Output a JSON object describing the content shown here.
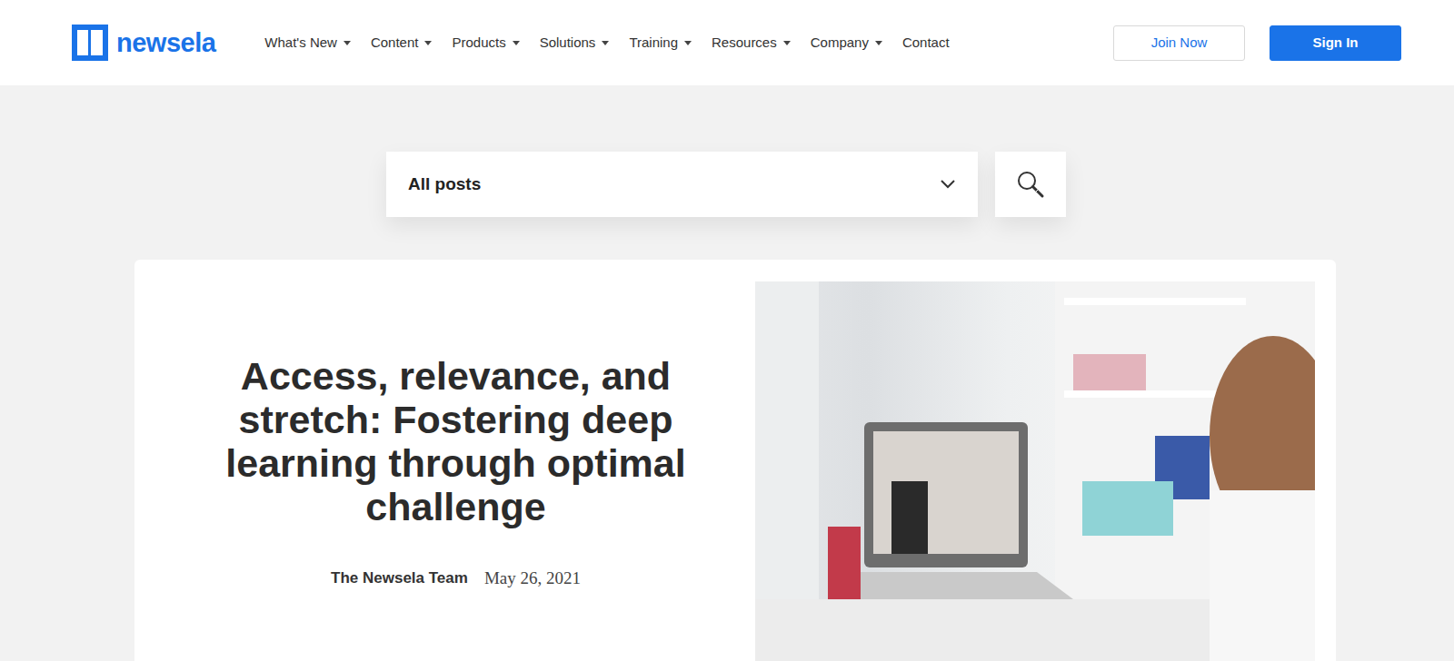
{
  "brand": {
    "name": "newsela"
  },
  "nav": {
    "items": [
      {
        "label": "What's New",
        "dropdown": true
      },
      {
        "label": "Content",
        "dropdown": true
      },
      {
        "label": "Products",
        "dropdown": true
      },
      {
        "label": "Solutions",
        "dropdown": true
      },
      {
        "label": "Training",
        "dropdown": true
      },
      {
        "label": "Resources",
        "dropdown": true
      },
      {
        "label": "Company",
        "dropdown": true
      },
      {
        "label": "Contact",
        "dropdown": false
      }
    ]
  },
  "buttons": [
    {
      "label": "Join Now",
      "kind": "outline"
    },
    {
      "label": "Sign In",
      "kind": "primary"
    }
  ],
  "filter": {
    "value": "All posts"
  },
  "post": {
    "title": "Access, relevance, and stretch: Fostering deep learning through optimal challenge",
    "author": "The Newsela Team",
    "date": "May 26, 2021"
  }
}
